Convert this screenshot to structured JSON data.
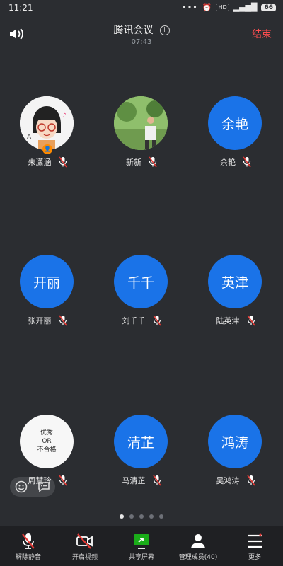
{
  "status_bar": {
    "time": "11:21",
    "dots": "•••",
    "network": "HD",
    "battery": "66"
  },
  "header": {
    "title": "腾讯会议",
    "duration": "07:43",
    "end_label": "结束"
  },
  "participants": [
    {
      "avatar_type": "cartoon",
      "avatar_text": "",
      "name": "朱潇涵",
      "is_host": true,
      "muted": true
    },
    {
      "avatar_type": "photo",
      "avatar_text": "",
      "name": "新新",
      "is_host": false,
      "muted": true
    },
    {
      "avatar_type": "text",
      "avatar_text": "余艳",
      "name": "余艳",
      "is_host": false,
      "muted": true
    },
    {
      "avatar_type": "text",
      "avatar_text": "开丽",
      "name": "张开丽",
      "is_host": false,
      "muted": true
    },
    {
      "avatar_type": "text",
      "avatar_text": "千千",
      "name": "刘千千",
      "is_host": false,
      "muted": true
    },
    {
      "avatar_type": "text",
      "avatar_text": "英津",
      "name": "陆英津",
      "is_host": false,
      "muted": true
    },
    {
      "avatar_type": "white",
      "avatar_lines": [
        "优秀",
        "OR",
        "不合格"
      ],
      "name": "周慧玲",
      "is_host": false,
      "muted": true
    },
    {
      "avatar_type": "text",
      "avatar_text": "清芷",
      "name": "马清芷",
      "is_host": false,
      "muted": true
    },
    {
      "avatar_type": "text",
      "avatar_text": "鸿涛",
      "name": "吴鸿涛",
      "is_host": false,
      "muted": true
    }
  ],
  "pager": {
    "count": 5,
    "active": 0
  },
  "toolbar": {
    "unmute_label": "解除静音",
    "video_label": "开启视频",
    "share_label": "共享屏幕",
    "members_label": "管理成员(40)",
    "more_label": "更多"
  },
  "colors": {
    "background": "#2b2d31",
    "accent_blue": "#1a73e8",
    "end_red": "#ff4d4f",
    "mute_red": "#e53935",
    "share_green": "#1aad19"
  }
}
